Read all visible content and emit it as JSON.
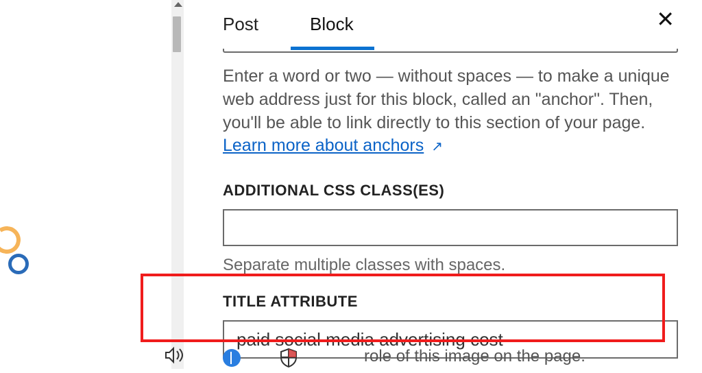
{
  "tabs": {
    "post": "Post",
    "block": "Block"
  },
  "anchor": {
    "help_pre": "Enter a word or two — without spaces — to make a unique web address just for this block, called an \"anchor\". Then, you'll be able to link directly to this section of your page. ",
    "link_text": "Learn more about anchors",
    "link_suffix": "↗"
  },
  "css": {
    "label": "ADDITIONAL CSS CLASS(ES)",
    "value": "",
    "help": "Separate multiple classes with spaces."
  },
  "title_attr": {
    "label": "TITLE ATTRIBUTE",
    "value": "paid social media advertising cost",
    "help_fragment": "role of this image on the page."
  }
}
